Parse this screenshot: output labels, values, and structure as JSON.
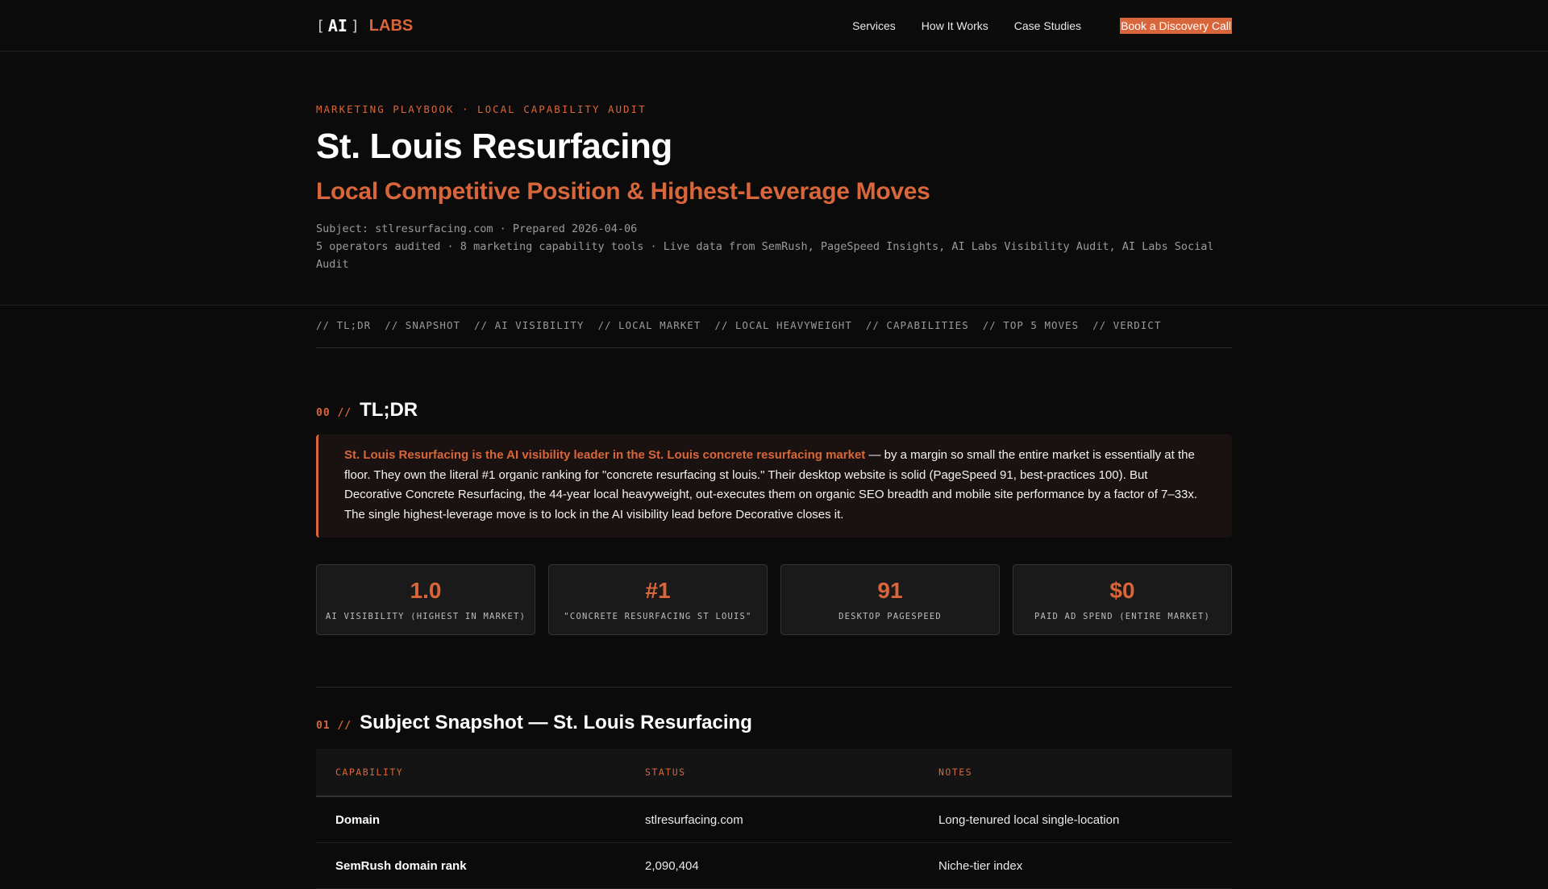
{
  "brand": {
    "bracket_open": "[",
    "ai": "AI",
    "bracket_close": "]",
    "labs": "LABS"
  },
  "nav": {
    "links": [
      "Services",
      "How It Works",
      "Case Studies"
    ],
    "cta": "Book a Discovery Call"
  },
  "hero": {
    "eyebrow": "MARKETING PLAYBOOK · LOCAL CAPABILITY AUDIT",
    "title": "St. Louis Resurfacing",
    "subtitle": "Local Competitive Position & Highest-Leverage Moves",
    "meta_line1": "Subject: stlresurfacing.com · Prepared 2026-04-06",
    "meta_line2": "5 operators audited · 8 marketing capability tools · Live data from SemRush, PageSpeed Insights, AI Labs Visibility Audit, AI Labs Social Audit"
  },
  "section_nav": [
    "// TL;DR",
    "// SNAPSHOT",
    "// AI VISIBILITY",
    "// LOCAL MARKET",
    "// LOCAL HEAVYWEIGHT",
    "// CAPABILITIES",
    "// TOP 5 MOVES",
    "// VERDICT"
  ],
  "tldr": {
    "num": "00 //",
    "heading": "TL;DR",
    "highlight": "St. Louis Resurfacing is the AI visibility leader in the St. Louis concrete resurfacing market",
    "body": " — by a margin so small the entire market is essentially at the floor. They own the literal #1 organic ranking for \"concrete resurfacing st louis.\" Their desktop website is solid (PageSpeed 91, best-practices 100). But Decorative Concrete Resurfacing, the 44-year local heavyweight, out-executes them on organic SEO breadth and mobile site performance by a factor of 7–33x. The single highest-leverage move is to lock in the AI visibility lead before Decorative closes it."
  },
  "stats": [
    {
      "value": "1.0",
      "label": "AI VISIBILITY (HIGHEST IN MARKET)"
    },
    {
      "value": "#1",
      "label": "\"CONCRETE RESURFACING ST LOUIS\""
    },
    {
      "value": "91",
      "label": "DESKTOP PAGESPEED"
    },
    {
      "value": "$0",
      "label": "PAID AD SPEND (ENTIRE MARKET)"
    }
  ],
  "snapshot": {
    "num": "01 //",
    "heading": "Subject Snapshot — St. Louis Resurfacing",
    "columns": [
      "CAPABILITY",
      "STATUS",
      "NOTES"
    ],
    "rows": [
      [
        "Domain",
        "stlresurfacing.com",
        "Long-tenured local single-location"
      ],
      [
        "SemRush domain rank",
        "2,090,404",
        "Niche-tier index"
      ]
    ]
  },
  "colors": {
    "accent": "#d9663a",
    "background": "#0b0b0b"
  }
}
